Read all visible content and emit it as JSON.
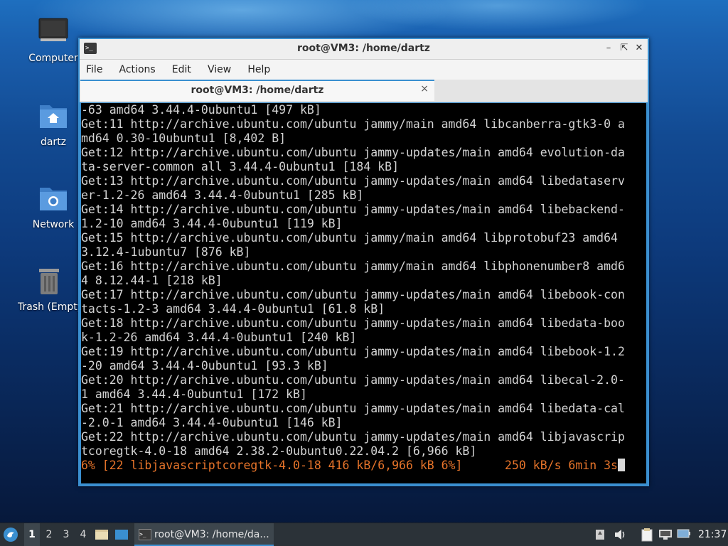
{
  "desktop": {
    "icons": [
      {
        "label": "Computer"
      },
      {
        "label": "dartz"
      },
      {
        "label": "Network"
      },
      {
        "label": "Trash (Empty)"
      }
    ]
  },
  "window": {
    "title": "root@VM3: /home/dartz",
    "menu": [
      "File",
      "Edit",
      "View",
      "Help",
      "Actions"
    ],
    "menu_items": {
      "file": "File",
      "actions": "Actions",
      "edit": "Edit",
      "view": "View",
      "help": "Help"
    },
    "tab_label": "root@VM3: /home/dartz",
    "tab_close": "×"
  },
  "terminal": {
    "lines": [
      "-63 amd64 3.44.4-0ubuntu1 [497 kB]",
      "Get:11 http://archive.ubuntu.com/ubuntu jammy/main amd64 libcanberra-gtk3-0 a",
      "md64 0.30-10ubuntu1 [8,402 B]",
      "Get:12 http://archive.ubuntu.com/ubuntu jammy-updates/main amd64 evolution-da",
      "ta-server-common all 3.44.4-0ubuntu1 [184 kB]",
      "Get:13 http://archive.ubuntu.com/ubuntu jammy-updates/main amd64 libedataserv",
      "er-1.2-26 amd64 3.44.4-0ubuntu1 [285 kB]",
      "Get:14 http://archive.ubuntu.com/ubuntu jammy-updates/main amd64 libebackend-",
      "1.2-10 amd64 3.44.4-0ubuntu1 [119 kB]",
      "Get:15 http://archive.ubuntu.com/ubuntu jammy/main amd64 libprotobuf23 amd64",
      "3.12.4-1ubuntu7 [876 kB]",
      "Get:16 http://archive.ubuntu.com/ubuntu jammy/main amd64 libphonenumber8 amd6",
      "4 8.12.44-1 [218 kB]",
      "Get:17 http://archive.ubuntu.com/ubuntu jammy-updates/main amd64 libebook-con",
      "tacts-1.2-3 amd64 3.44.4-0ubuntu1 [61.8 kB]",
      "Get:18 http://archive.ubuntu.com/ubuntu jammy-updates/main amd64 libedata-boo",
      "k-1.2-26 amd64 3.44.4-0ubuntu1 [240 kB]",
      "Get:19 http://archive.ubuntu.com/ubuntu jammy-updates/main amd64 libebook-1.2",
      "-20 amd64 3.44.4-0ubuntu1 [93.3 kB]",
      "Get:20 http://archive.ubuntu.com/ubuntu jammy-updates/main amd64 libecal-2.0-",
      "1 amd64 3.44.4-0ubuntu1 [172 kB]",
      "Get:21 http://archive.ubuntu.com/ubuntu jammy-updates/main amd64 libedata-cal",
      "-2.0-1 amd64 3.44.4-0ubuntu1 [146 kB]",
      "Get:22 http://archive.ubuntu.com/ubuntu jammy-updates/main amd64 libjavascrip",
      "tcoregtk-4.0-18 amd64 2.38.2-0ubuntu0.22.04.2 [6,966 kB]"
    ],
    "progress_line": "6% [22 libjavascriptcoregtk-4.0-18 416 kB/6,966 kB 6%]      250 kB/s 6min 3s",
    "colors": {
      "background": "#000000",
      "text": "#d3d3d3",
      "progress": "#e7742a"
    }
  },
  "taskbar": {
    "workspaces": [
      "1",
      "2",
      "3",
      "4"
    ],
    "active_workspace": "1",
    "task_label": "root@VM3: /home/da...",
    "clock": "21:37",
    "icons": [
      "start-menu-icon",
      "file-manager-icon",
      "show-desktop-icon",
      "terminal-icon",
      "notifications-icon",
      "volume-icon",
      "clipboard-icon",
      "network-icon",
      "battery-icon"
    ]
  }
}
